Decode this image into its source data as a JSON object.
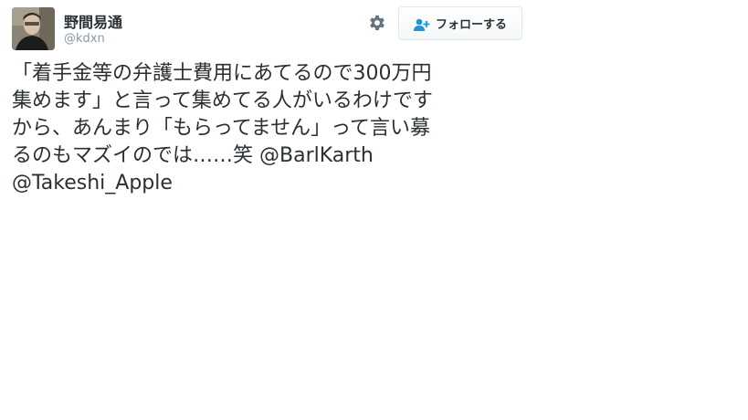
{
  "user": {
    "display_name": "野間易通",
    "screen_name": "@kdxn",
    "avatar_icon": "user-avatar-photo"
  },
  "actions": {
    "settings_icon": "gear-icon",
    "follow_label": "フォローする",
    "follow_icon": "add-user-icon"
  },
  "tweet": {
    "lines": [
      "「着手金等の弁護士費用にあてるので300万円",
      "集めます」と言って集めてる人がいるわけです",
      "から、あんまり「もらってません」って言い募",
      "るのもマズイのでは……笑 "
    ],
    "mention_1": "@BarlKarth",
    "mention_2": "@Takeshi_Apple"
  },
  "colors": {
    "text": "#292f33",
    "muted": "#8899a6",
    "accent": "#1b95e0",
    "border": "#e1e8ed"
  }
}
